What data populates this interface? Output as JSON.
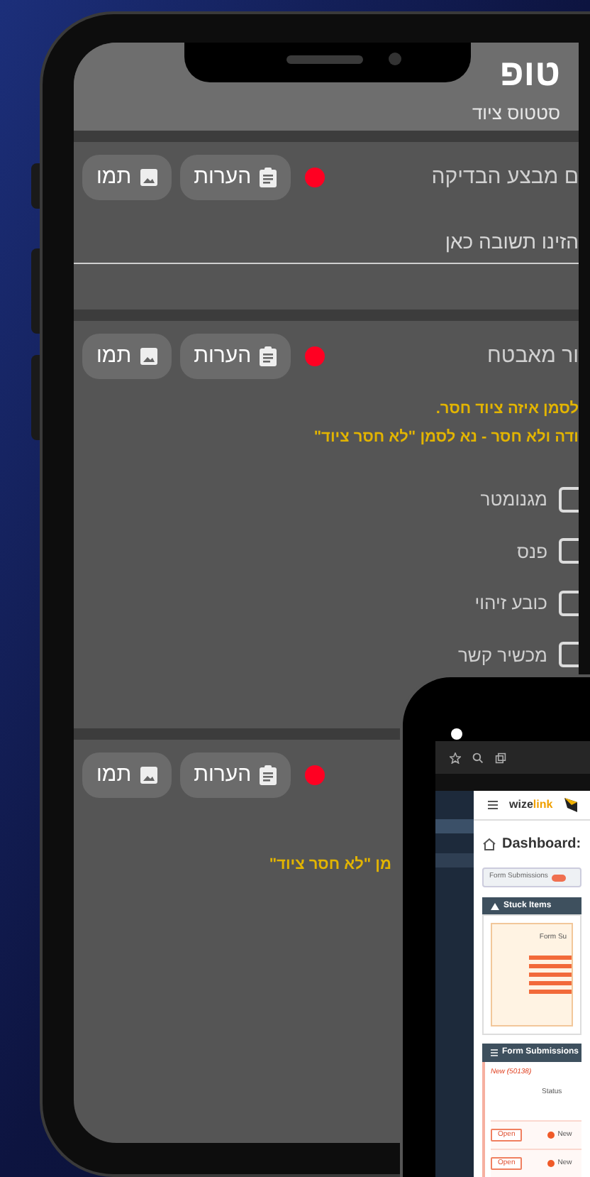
{
  "phone": {
    "header": {
      "title": "טופ",
      "subtitle": "סטטוס ציוד"
    },
    "questions": [
      {
        "kind": "text",
        "title": "ם מבצע הבדיקה",
        "required": true,
        "buttons": [
          {
            "kind": "notes",
            "label": "הערות"
          },
          {
            "kind": "image",
            "label": "תמו"
          }
        ],
        "placeholder": "הזינו תשובה כאן"
      },
      {
        "kind": "checklist",
        "title": "ור מאבטח",
        "required": true,
        "buttons": [
          {
            "kind": "notes",
            "label": "הערות"
          },
          {
            "kind": "image",
            "label": "תמו"
          }
        ],
        "notes": [
          "לסמן איזה ציוד חסר.",
          "ודה ולא חסר - נא לסמן \"לא חסר ציוד\""
        ],
        "options": [
          {
            "label": "מגנומטר",
            "checked": false
          },
          {
            "label": "פנס",
            "checked": false
          },
          {
            "label": "כובע זיהוי",
            "checked": false
          },
          {
            "label": "מכשיר קשר",
            "checked": false
          }
        ]
      },
      {
        "kind": "checklist",
        "required": true,
        "buttons": [
          {
            "kind": "notes",
            "label": "הערות"
          },
          {
            "kind": "image",
            "label": "תמו"
          }
        ],
        "notes": [
          "מן \"לא חסר ציוד\""
        ]
      }
    ]
  },
  "tablet": {
    "logo_dark": "wize",
    "logo_accent": "link",
    "title": "Dashboard:",
    "tabs": [
      {
        "label": "Form Submissions",
        "selected": true
      }
    ],
    "stuck_items": {
      "header": "Stuck Items",
      "chart_title": "Form Su"
    },
    "form_submissions": {
      "header": "Form Submissions",
      "group": "New (50138)",
      "columns": [
        "Status"
      ],
      "rows": [
        {
          "action": "Open",
          "status": "New"
        },
        {
          "action": "Open",
          "status": "New"
        }
      ]
    }
  }
}
